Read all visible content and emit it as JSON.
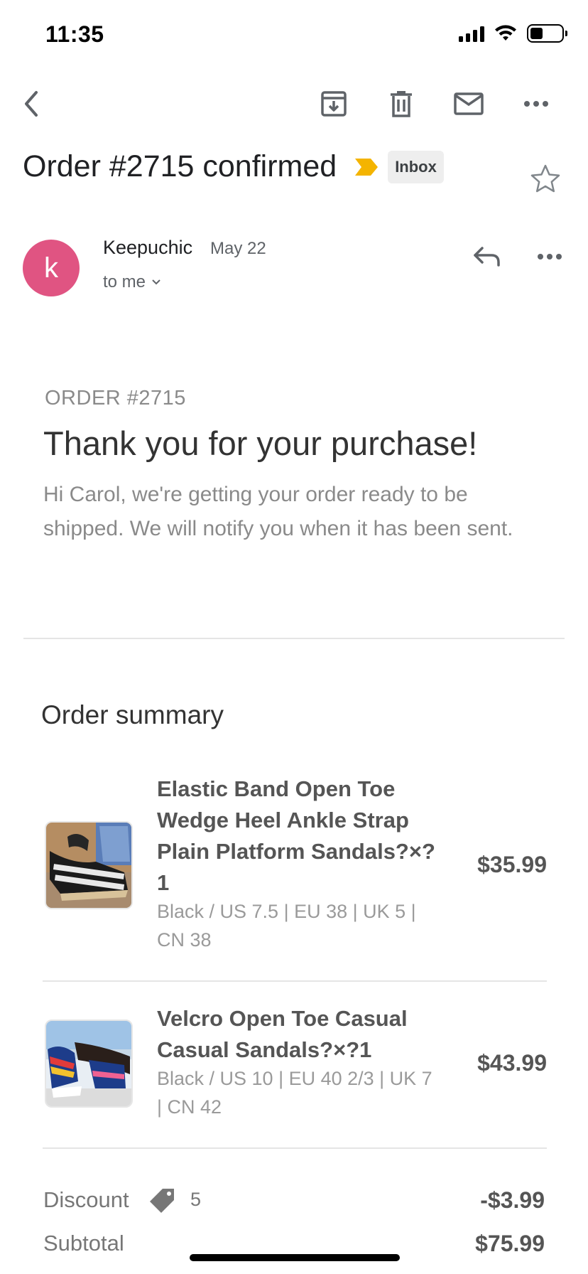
{
  "status_bar": {
    "time": "11:35"
  },
  "toolbar": {
    "back_icon": "chevron-left-icon",
    "archive_icon": "archive-icon",
    "delete_icon": "trash-icon",
    "mark_unread_icon": "mail-icon",
    "more_icon": "more-horizontal-icon"
  },
  "email": {
    "subject": "Order #2715 confirmed",
    "label": "Inbox",
    "importance_color": "#f4b400",
    "sender": {
      "initial": "k",
      "avatar_color": "#e05482",
      "name": "Keepuchic",
      "date": "May 22",
      "recipient": "to me"
    }
  },
  "body": {
    "order_number": "ORDER #2715",
    "heading": "Thank you for your purchase!",
    "intro": "Hi Carol, we're getting your order ready to be shipped. We will notify you when it has been sent.",
    "summary_title": "Order summary",
    "items": [
      {
        "title": "Elastic Band Open Toe Wedge Heel Ankle Strap Plain Platform Sandals?×? 1",
        "variant": "Black / US 7.5 | EU 38 | UK 5 | CN 38",
        "price": "$35.99"
      },
      {
        "title": "Velcro Open Toe Casual Casual Sandals?×?1",
        "variant": "Black / US 10 | EU 40 2/3 | UK 7 | CN 42",
        "price": "$43.99"
      }
    ],
    "totals": {
      "discount_label": "Discount",
      "discount_code": "5",
      "discount_value": "-$3.99",
      "subtotal_label": "Subtotal",
      "subtotal_value": "$75.99"
    }
  }
}
